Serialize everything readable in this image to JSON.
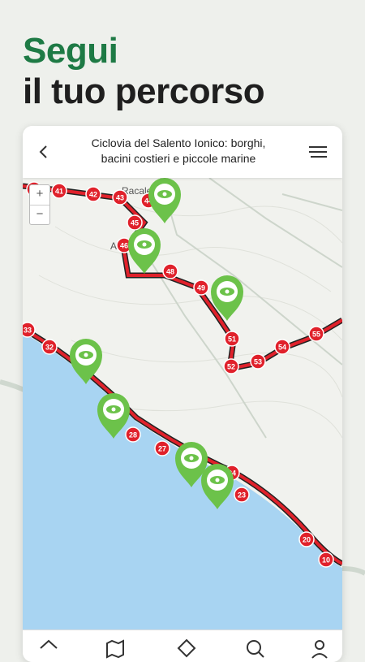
{
  "hero": {
    "line1": "Segui",
    "line2": "il tuo percorso"
  },
  "screen": {
    "title_line1": "Ciclovia del Salento Ionico: borghi,",
    "title_line2": "bacini costieri e piccole marine",
    "zoom_in": "+",
    "zoom_out": "−"
  },
  "map": {
    "place_labels": [
      "Racale",
      "Alliste"
    ],
    "waypoints": [
      "40",
      "41",
      "42",
      "43",
      "44",
      "45",
      "46",
      "48",
      "49",
      "51",
      "52",
      "53",
      "54",
      "55",
      "33",
      "32",
      "28",
      "27",
      "24",
      "23",
      "20",
      "10"
    ]
  },
  "bottom_nav": [
    "home-icon",
    "map-icon",
    "route-icon",
    "search-icon",
    "profile-icon"
  ],
  "colors": {
    "brand_green": "#1e7a45",
    "route_red": "#e0212b",
    "sea": "#a8d4f2",
    "poi_green": "#6cc24a"
  }
}
